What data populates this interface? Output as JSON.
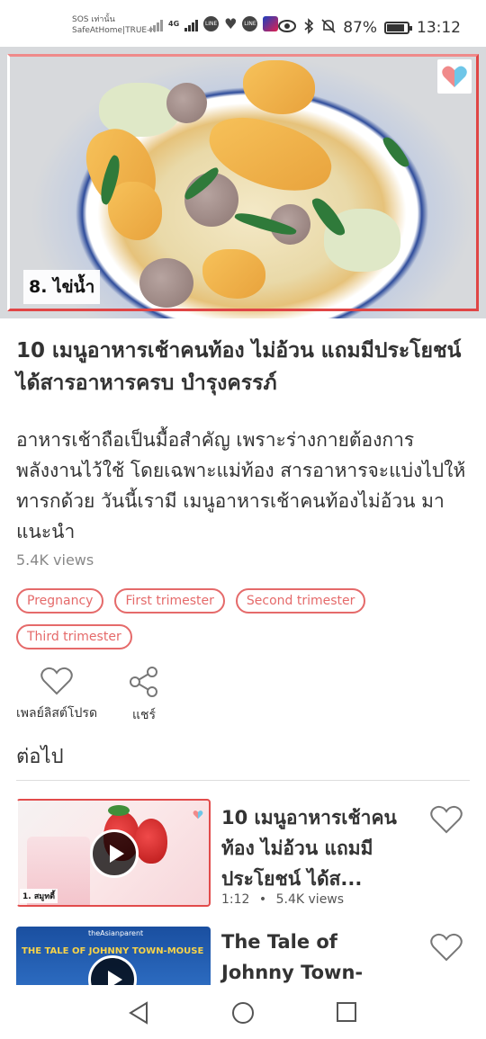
{
  "status_bar": {
    "carrier_line1": "SOS เท่านั้น",
    "carrier_line2": "SafeAtHome|TRUE-H",
    "network": "4G",
    "battery": "87%",
    "battery_level": 0.87,
    "time": "13:12"
  },
  "hero": {
    "caption": "8. ไข่น้ำ"
  },
  "article": {
    "title": "10 เมนูอาหารเช้าคนท้อง ไม่อ้วน แถมมีประโยชน์ ได้สารอาหารครบ บำรุงครรภ์",
    "description": "อาหารเช้าถือเป็นมื้อสำคัญ เพราะร่างกายต้องการพลังงานไว้ใช้ โดยเฉพาะแม่ท้อง สารอาหารจะแบ่งไปให้ทารกด้วย วันนี้เรามี เมนูอาหารเช้าคนท้องไม่อ้วน มาแนะนำ",
    "views": "5.4K views",
    "tags": [
      "Pregnancy",
      "First trimester",
      "Second trimester",
      "Third trimester"
    ]
  },
  "actions": {
    "like_label": "เพลย์ลิสต์โปรด",
    "share_label": "แชร์"
  },
  "next_section": {
    "header": "ต่อไป",
    "cards": [
      {
        "title": "10 เมนูอาหารเช้าคนท้อง ไม่อ้วน แถมมีประโยชน์ ได้ส...",
        "thumb_caption": "1. สมูทตี้",
        "duration": "1:12",
        "views": "5.4K views"
      },
      {
        "title": "The Tale of Johnny Town-mouse",
        "thumb_brand": "theAsianparent",
        "thumb_caption": "THE TALE OF JOHNNY TOWN-MOUSE"
      }
    ]
  }
}
